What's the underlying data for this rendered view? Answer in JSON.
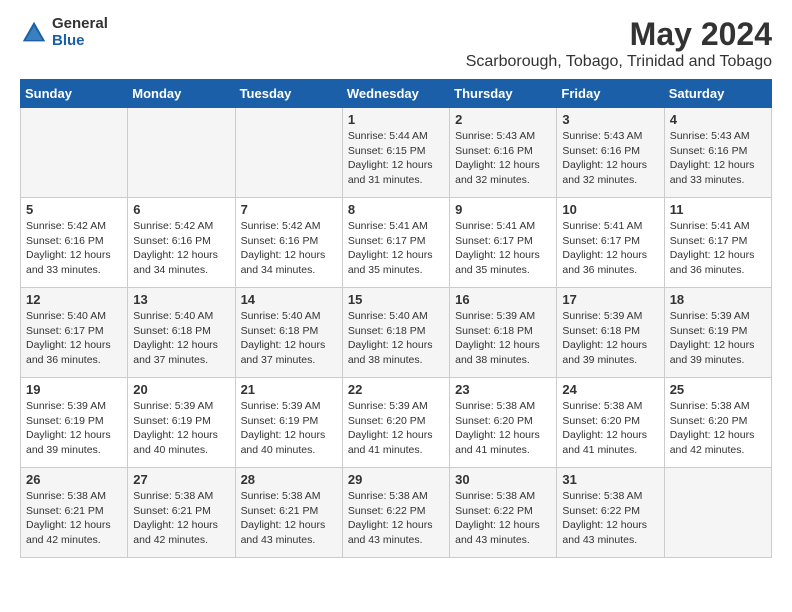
{
  "header": {
    "logo_general": "General",
    "logo_blue": "Blue",
    "title": "May 2024",
    "subtitle": "Scarborough, Tobago, Trinidad and Tobago"
  },
  "weekdays": [
    "Sunday",
    "Monday",
    "Tuesday",
    "Wednesday",
    "Thursday",
    "Friday",
    "Saturday"
  ],
  "weeks": [
    [
      {
        "day": "",
        "info": ""
      },
      {
        "day": "",
        "info": ""
      },
      {
        "day": "",
        "info": ""
      },
      {
        "day": "1",
        "info": "Sunrise: 5:44 AM\nSunset: 6:15 PM\nDaylight: 12 hours\nand 31 minutes."
      },
      {
        "day": "2",
        "info": "Sunrise: 5:43 AM\nSunset: 6:16 PM\nDaylight: 12 hours\nand 32 minutes."
      },
      {
        "day": "3",
        "info": "Sunrise: 5:43 AM\nSunset: 6:16 PM\nDaylight: 12 hours\nand 32 minutes."
      },
      {
        "day": "4",
        "info": "Sunrise: 5:43 AM\nSunset: 6:16 PM\nDaylight: 12 hours\nand 33 minutes."
      }
    ],
    [
      {
        "day": "5",
        "info": "Sunrise: 5:42 AM\nSunset: 6:16 PM\nDaylight: 12 hours\nand 33 minutes."
      },
      {
        "day": "6",
        "info": "Sunrise: 5:42 AM\nSunset: 6:16 PM\nDaylight: 12 hours\nand 34 minutes."
      },
      {
        "day": "7",
        "info": "Sunrise: 5:42 AM\nSunset: 6:16 PM\nDaylight: 12 hours\nand 34 minutes."
      },
      {
        "day": "8",
        "info": "Sunrise: 5:41 AM\nSunset: 6:17 PM\nDaylight: 12 hours\nand 35 minutes."
      },
      {
        "day": "9",
        "info": "Sunrise: 5:41 AM\nSunset: 6:17 PM\nDaylight: 12 hours\nand 35 minutes."
      },
      {
        "day": "10",
        "info": "Sunrise: 5:41 AM\nSunset: 6:17 PM\nDaylight: 12 hours\nand 36 minutes."
      },
      {
        "day": "11",
        "info": "Sunrise: 5:41 AM\nSunset: 6:17 PM\nDaylight: 12 hours\nand 36 minutes."
      }
    ],
    [
      {
        "day": "12",
        "info": "Sunrise: 5:40 AM\nSunset: 6:17 PM\nDaylight: 12 hours\nand 36 minutes."
      },
      {
        "day": "13",
        "info": "Sunrise: 5:40 AM\nSunset: 6:18 PM\nDaylight: 12 hours\nand 37 minutes."
      },
      {
        "day": "14",
        "info": "Sunrise: 5:40 AM\nSunset: 6:18 PM\nDaylight: 12 hours\nand 37 minutes."
      },
      {
        "day": "15",
        "info": "Sunrise: 5:40 AM\nSunset: 6:18 PM\nDaylight: 12 hours\nand 38 minutes."
      },
      {
        "day": "16",
        "info": "Sunrise: 5:39 AM\nSunset: 6:18 PM\nDaylight: 12 hours\nand 38 minutes."
      },
      {
        "day": "17",
        "info": "Sunrise: 5:39 AM\nSunset: 6:18 PM\nDaylight: 12 hours\nand 39 minutes."
      },
      {
        "day": "18",
        "info": "Sunrise: 5:39 AM\nSunset: 6:19 PM\nDaylight: 12 hours\nand 39 minutes."
      }
    ],
    [
      {
        "day": "19",
        "info": "Sunrise: 5:39 AM\nSunset: 6:19 PM\nDaylight: 12 hours\nand 39 minutes."
      },
      {
        "day": "20",
        "info": "Sunrise: 5:39 AM\nSunset: 6:19 PM\nDaylight: 12 hours\nand 40 minutes."
      },
      {
        "day": "21",
        "info": "Sunrise: 5:39 AM\nSunset: 6:19 PM\nDaylight: 12 hours\nand 40 minutes."
      },
      {
        "day": "22",
        "info": "Sunrise: 5:39 AM\nSunset: 6:20 PM\nDaylight: 12 hours\nand 41 minutes."
      },
      {
        "day": "23",
        "info": "Sunrise: 5:38 AM\nSunset: 6:20 PM\nDaylight: 12 hours\nand 41 minutes."
      },
      {
        "day": "24",
        "info": "Sunrise: 5:38 AM\nSunset: 6:20 PM\nDaylight: 12 hours\nand 41 minutes."
      },
      {
        "day": "25",
        "info": "Sunrise: 5:38 AM\nSunset: 6:20 PM\nDaylight: 12 hours\nand 42 minutes."
      }
    ],
    [
      {
        "day": "26",
        "info": "Sunrise: 5:38 AM\nSunset: 6:21 PM\nDaylight: 12 hours\nand 42 minutes."
      },
      {
        "day": "27",
        "info": "Sunrise: 5:38 AM\nSunset: 6:21 PM\nDaylight: 12 hours\nand 42 minutes."
      },
      {
        "day": "28",
        "info": "Sunrise: 5:38 AM\nSunset: 6:21 PM\nDaylight: 12 hours\nand 43 minutes."
      },
      {
        "day": "29",
        "info": "Sunrise: 5:38 AM\nSunset: 6:22 PM\nDaylight: 12 hours\nand 43 minutes."
      },
      {
        "day": "30",
        "info": "Sunrise: 5:38 AM\nSunset: 6:22 PM\nDaylight: 12 hours\nand 43 minutes."
      },
      {
        "day": "31",
        "info": "Sunrise: 5:38 AM\nSunset: 6:22 PM\nDaylight: 12 hours\nand 43 minutes."
      },
      {
        "day": "",
        "info": ""
      }
    ]
  ]
}
